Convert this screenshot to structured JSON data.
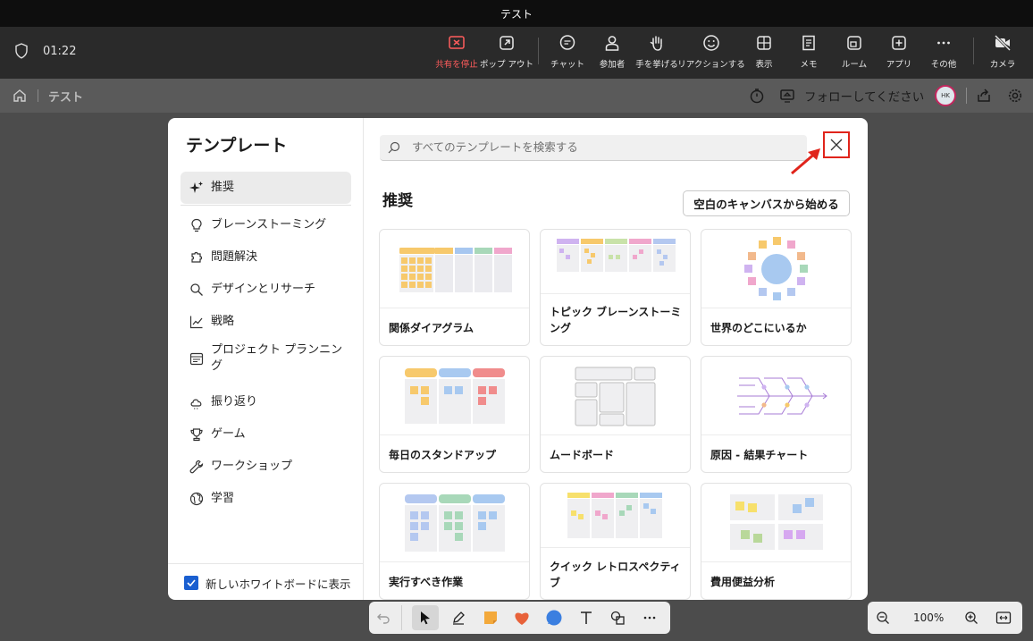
{
  "window": {
    "title": "テスト"
  },
  "meeting": {
    "timer": "01:22",
    "buttons": [
      {
        "label": "共有を停止",
        "icon": "stop-share-icon"
      },
      {
        "label": "ポップ アウト",
        "icon": "popout-icon"
      },
      {
        "label": "チャット",
        "icon": "chat-icon"
      },
      {
        "label": "参加者",
        "icon": "people-icon"
      },
      {
        "label": "手を挙げる",
        "icon": "raise-hand-icon"
      },
      {
        "label": "リアクションする",
        "icon": "reaction-icon"
      },
      {
        "label": "表示",
        "icon": "view-icon"
      },
      {
        "label": "メモ",
        "icon": "notes-icon"
      },
      {
        "label": "ルーム",
        "icon": "rooms-icon"
      },
      {
        "label": "アプリ",
        "icon": "apps-icon"
      },
      {
        "label": "その他",
        "icon": "more-icon"
      },
      {
        "label": "カメラ",
        "icon": "camera-off-icon"
      }
    ],
    "accent_stop": "#ff5c5c"
  },
  "appbar": {
    "title": "テスト",
    "follow_label": "フォローしてください",
    "avatar_initials": "HK"
  },
  "modal": {
    "title": "テンプレート",
    "nav": [
      {
        "label": "推奨",
        "icon": "sparkle-icon"
      },
      {
        "label": "ブレーンストーミング",
        "icon": "lightbulb-icon"
      },
      {
        "label": "問題解決",
        "icon": "puzzle-icon"
      },
      {
        "label": "デザインとリサーチ",
        "icon": "search-icon"
      },
      {
        "label": "戦略",
        "icon": "chart-line-icon"
      },
      {
        "label": "プロジェクト プランニング",
        "icon": "calendar-icon"
      },
      {
        "label": "振り返り",
        "icon": "cloud-icon"
      },
      {
        "label": "ゲーム",
        "icon": "trophy-icon"
      },
      {
        "label": "ワークショップ",
        "icon": "wrench-icon"
      },
      {
        "label": "学習",
        "icon": "globe-icon"
      }
    ],
    "show_on_new_label": "新しいホワイトボードに表示",
    "search_placeholder": "すべてのテンプレートを検索する",
    "section_title": "推奨",
    "blank_button": "空白のキャンバスから始める",
    "templates": [
      {
        "title": "関係ダイアグラム"
      },
      {
        "title": "トピック ブレーンストーミング"
      },
      {
        "title": "世界のどこにいるか"
      },
      {
        "title": "毎日のスタンドアップ"
      },
      {
        "title": "ムードボード"
      },
      {
        "title": "原因 - 結果チャート"
      },
      {
        "title": "実行すべき作業"
      },
      {
        "title": "クイック レトロスペクティブ"
      },
      {
        "title": "費用便益分析"
      }
    ]
  },
  "zoom": {
    "level": "100%"
  }
}
